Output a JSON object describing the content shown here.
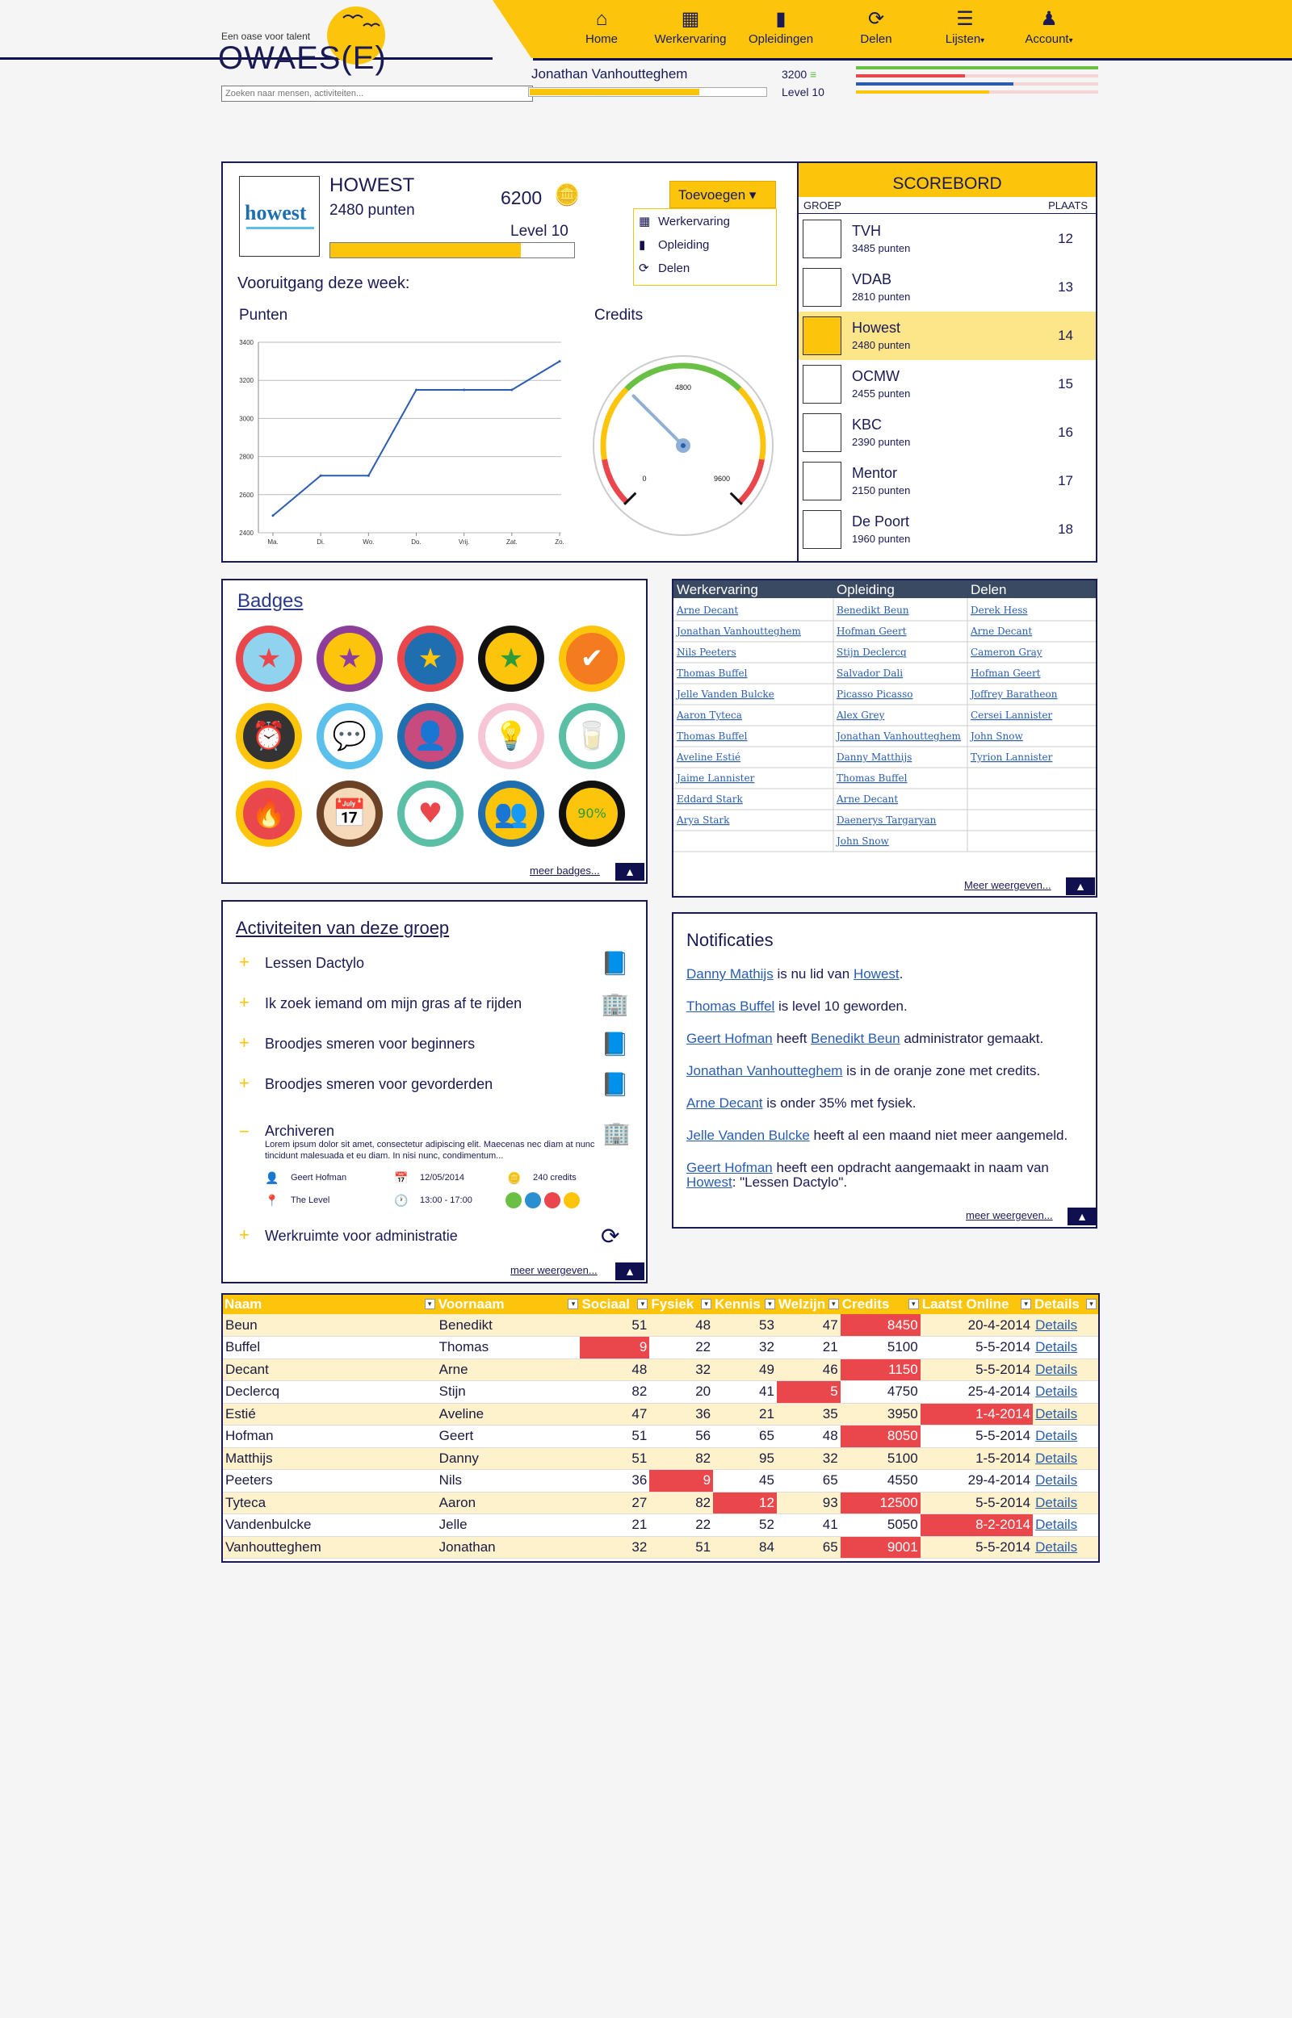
{
  "header": {
    "logo_tagline": "Een oase voor talent",
    "logo": "OWAES(E)",
    "search_placeholder": "Zoeken naar mensen, activiteiten...",
    "nav": [
      {
        "label": "Home",
        "icon": "home-icon"
      },
      {
        "label": "Werkervaring",
        "icon": "building-icon"
      },
      {
        "label": "Opleidingen",
        "icon": "book-icon"
      },
      {
        "label": "Delen",
        "icon": "refresh-icon"
      },
      {
        "label": "Lijsten",
        "icon": "list-icon"
      },
      {
        "label": "Account",
        "icon": "user-icon"
      }
    ],
    "user_name": "Jonathan Vanhoutteghem",
    "user_credits": "3200",
    "user_level": "Level 10",
    "user_progress": 0.72,
    "stat_bars": [
      {
        "color": "#6abf45",
        "value": 1.0
      },
      {
        "color": "#e9474b",
        "value": 0.45
      },
      {
        "color": "#2a5db0",
        "value": 0.65
      },
      {
        "color": "#fcc50c",
        "value": 0.55
      }
    ]
  },
  "profile": {
    "logo_text": "howest",
    "name": "HOWEST",
    "points": "2480 punten",
    "credits": "6200",
    "level": "Level 10",
    "level_progress": 0.78,
    "add_button": "Toevoegen",
    "add_menu": [
      "Werkervaring",
      "Opleiding",
      "Delen"
    ],
    "progress_title": "Vooruitgang deze week:",
    "points_label": "Punten",
    "credits_label": "Credits"
  },
  "chart_data": [
    {
      "type": "line",
      "title": "Punten",
      "categories": [
        "Ma.",
        "Di.",
        "Wo.",
        "Do.",
        "Vrij.",
        "Zat.",
        "Zo."
      ],
      "values": [
        2490,
        2700,
        2700,
        3150,
        3150,
        3150,
        3300
      ],
      "ylim": [
        2400,
        3400
      ],
      "yticks": [
        "3400",
        "3200",
        "3000",
        "2800",
        "2600",
        "2400"
      ],
      "grid": true
    },
    {
      "type": "gauge",
      "title": "Credits",
      "min_label": "0",
      "mid_label": "4800",
      "max_label": "9600",
      "value": 3200,
      "max": 9600
    }
  ],
  "scoreboard": {
    "title": "SCOREBORD",
    "col_group": "GROEP",
    "col_place": "PLAATS",
    "rows": [
      {
        "name": "TVH",
        "points": "3485 punten",
        "place": "12"
      },
      {
        "name": "VDAB",
        "points": "2810 punten",
        "place": "13"
      },
      {
        "name": "Howest",
        "points": "2480 punten",
        "place": "14",
        "highlight": true
      },
      {
        "name": "OCMW",
        "points": "2455 punten",
        "place": "15"
      },
      {
        "name": "KBC",
        "points": "2390 punten",
        "place": "16"
      },
      {
        "name": "Mentor",
        "points": "2150 punten",
        "place": "17"
      },
      {
        "name": "De Poort",
        "points": "1960 punten",
        "place": "18"
      }
    ]
  },
  "badges": {
    "title": "Badges",
    "more": "meer badges...",
    "items": [
      {
        "icon": "star-icon",
        "ring": "#e9474b",
        "fill": "#8fd3ef",
        "glyph": "★",
        "gc": "#e9474b"
      },
      {
        "icon": "star-icon",
        "ring": "#8d3e9b",
        "fill": "#fcc50c",
        "glyph": "★",
        "gc": "#8d3e9b"
      },
      {
        "icon": "star-icon",
        "ring": "#e9474b",
        "fill": "#1f6fb0",
        "glyph": "★",
        "gc": "#fcc50c"
      },
      {
        "icon": "star-icon",
        "ring": "#111111",
        "fill": "#fcc50c",
        "glyph": "★",
        "gc": "#2e9b3a"
      },
      {
        "icon": "checkmark-icon",
        "ring": "#fcc50c",
        "fill": "#f47b20",
        "glyph": "✔",
        "gc": "#ffffff"
      },
      {
        "icon": "alarm-clock-icon",
        "ring": "#fcc50c",
        "fill": "#333333",
        "glyph": "⏰",
        "gc": "#fcc50c"
      },
      {
        "icon": "chat-icon",
        "ring": "#5bc0eb",
        "fill": "#ffffff",
        "glyph": "💬",
        "gc": "#5bc0eb"
      },
      {
        "icon": "person-icon",
        "ring": "#1f6fb0",
        "fill": "#c74b7d",
        "glyph": "👤",
        "gc": "#1f6fb0"
      },
      {
        "icon": "lightbulb-icon",
        "ring": "#f7c6d6",
        "fill": "#ffffff",
        "glyph": "💡",
        "gc": "#fcc50c"
      },
      {
        "icon": "cup-icon",
        "ring": "#5bbfa6",
        "fill": "#ffffff",
        "glyph": "🥛",
        "gc": "#5bbfa6"
      },
      {
        "icon": "fire-icon",
        "ring": "#fcc50c",
        "fill": "#e9474b",
        "glyph": "🔥",
        "gc": "#fcc50c"
      },
      {
        "icon": "calendar-icon",
        "ring": "#6b4226",
        "fill": "#f5d9b9",
        "glyph": "📅",
        "gc": "#6b4226"
      },
      {
        "icon": "heart-cup-icon",
        "ring": "#5bbfa6",
        "fill": "#ffffff",
        "glyph": "♥",
        "gc": "#e9474b"
      },
      {
        "icon": "people-icon",
        "ring": "#1f6fb0",
        "fill": "#fcc50c",
        "glyph": "👥",
        "gc": "#1f6fb0"
      },
      {
        "icon": "sign-icon",
        "ring": "#111111",
        "fill": "#fcc50c",
        "glyph": "90%",
        "gc": "#2e9b3a"
      }
    ]
  },
  "lists": {
    "headers": [
      "Werkervaring",
      "Opleiding",
      "Delen"
    ],
    "more": "Meer weergeven...",
    "col1": [
      "Arne Decant",
      "Jonathan Vanhoutteghem",
      "Nils Peeters",
      "Thomas Buffel",
      "Jelle Vanden Bulcke",
      "Aaron Tyteca",
      "Thomas Buffel",
      "Aveline Estié",
      "Jaime Lannister",
      "Eddard Stark",
      "Arya Stark",
      ""
    ],
    "col2": [
      "Benedikt Beun",
      "Hofman Geert",
      "Stijn Declercq",
      "Salvador Dali",
      "Picasso Picasso",
      "Alex Grey",
      "Jonathan Vanhoutteghem",
      "Danny Matthijs",
      "Thomas Buffel",
      "Arne Decant",
      "Daenerys Targaryan",
      "John Snow"
    ],
    "col3": [
      "Derek Hess",
      "Arne Decant",
      "Cameron Gray",
      "Hofman Geert",
      "Joffrey Baratheon",
      "Cersei Lannister",
      "John Snow",
      "Tyrion Lannister",
      "",
      "",
      "",
      ""
    ]
  },
  "activities": {
    "title": "Activiteiten van deze groep",
    "more": "meer weergeven...",
    "items": [
      {
        "label": "Lessen Dactylo",
        "icon": "book-icon",
        "glyph": "📘"
      },
      {
        "label": "Ik zoek iemand om mijn gras af te rijden",
        "icon": "building-icon",
        "glyph": "🏢"
      },
      {
        "label": "Broodjes smeren voor beginners",
        "icon": "book-icon",
        "glyph": "📘"
      },
      {
        "label": "Broodjes smeren voor gevorderden",
        "icon": "book-icon",
        "glyph": "📘"
      }
    ],
    "expanded": {
      "label": "Archiveren",
      "desc": "Lorem ipsum dolor sit amet, consectetur adipiscing elit. Maecenas nec diam at nunc tincidunt malesuada et eu diam. In nisi nunc, condimentum...",
      "owner": "Geert Hofman",
      "date": "12/05/2014",
      "credits": "240 credits",
      "location": "The Level",
      "time": "13:00 - 17:00"
    },
    "last": "Werkruimte voor administratie"
  },
  "notifications": {
    "title": "Notificaties",
    "more": "meer weergeven...",
    "items": [
      {
        "a": "Danny Mathijs",
        "t1": " is nu lid van ",
        "b": "Howest",
        "t2": "."
      },
      {
        "a": "Thomas Buffel",
        "t1": " is level 10 geworden.",
        "b": "",
        "t2": ""
      },
      {
        "a": "Geert Hofman",
        "t1": " heeft ",
        "b": "Benedikt Beun",
        "t2": " administrator gemaakt."
      },
      {
        "a": "Jonathan Vanhoutteghem",
        "t1": " is in de oranje zone met credits.",
        "b": "",
        "t2": ""
      },
      {
        "a": "Arne Decant",
        "t1": " is onder 35% met fysiek.",
        "b": "",
        "t2": ""
      },
      {
        "a": "Jelle Vanden Bulcke",
        "t1": " heeft al een maand niet meer aangemeld.",
        "b": "",
        "t2": ""
      },
      {
        "a": "Geert Hofman",
        "t1": " heeft een opdracht aangemaakt in naam van ",
        "b": "Howest",
        "t2": ": \"Lessen Dactylo\"."
      }
    ]
  },
  "table": {
    "headers": [
      "Naam",
      "Voornaam",
      "Sociaal",
      "Fysiek",
      "Kennis",
      "Welzijn",
      "Credits",
      "Laatst Online",
      "Details"
    ],
    "rows": [
      [
        "Beun",
        "Benedikt",
        "51",
        "48",
        "53",
        "47",
        "8450",
        "20-4-2014",
        "Details"
      ],
      [
        "Buffel",
        "Thomas",
        "9",
        "22",
        "32",
        "21",
        "5100",
        "5-5-2014",
        "Details"
      ],
      [
        "Decant",
        "Arne",
        "48",
        "32",
        "49",
        "46",
        "1150",
        "5-5-2014",
        "Details"
      ],
      [
        "Declercq",
        "Stijn",
        "82",
        "20",
        "41",
        "5",
        "4750",
        "25-4-2014",
        "Details"
      ],
      [
        "Estié",
        "Aveline",
        "47",
        "36",
        "21",
        "35",
        "3950",
        "1-4-2014",
        "Details"
      ],
      [
        "Hofman",
        "Geert",
        "51",
        "56",
        "65",
        "48",
        "8050",
        "5-5-2014",
        "Details"
      ],
      [
        "Matthijs",
        "Danny",
        "51",
        "82",
        "95",
        "32",
        "5100",
        "1-5-2014",
        "Details"
      ],
      [
        "Peeters",
        "Nils",
        "36",
        "9",
        "45",
        "65",
        "4550",
        "29-4-2014",
        "Details"
      ],
      [
        "Tyteca",
        "Aaron",
        "27",
        "82",
        "12",
        "93",
        "12500",
        "5-5-2014",
        "Details"
      ],
      [
        "Vandenbulcke",
        "Jelle",
        "21",
        "22",
        "52",
        "41",
        "5050",
        "8-2-2014",
        "Details"
      ],
      [
        "Vanhoutteghem",
        "Jonathan",
        "32",
        "51",
        "84",
        "65",
        "9001",
        "5-5-2014",
        "Details"
      ]
    ],
    "red_cells": [
      [
        0,
        6
      ],
      [
        1,
        2
      ],
      [
        2,
        6
      ],
      [
        3,
        5
      ],
      [
        4,
        7
      ],
      [
        5,
        6
      ],
      [
        7,
        3
      ],
      [
        8,
        4
      ],
      [
        8,
        6
      ],
      [
        9,
        7
      ],
      [
        10,
        6
      ]
    ]
  }
}
